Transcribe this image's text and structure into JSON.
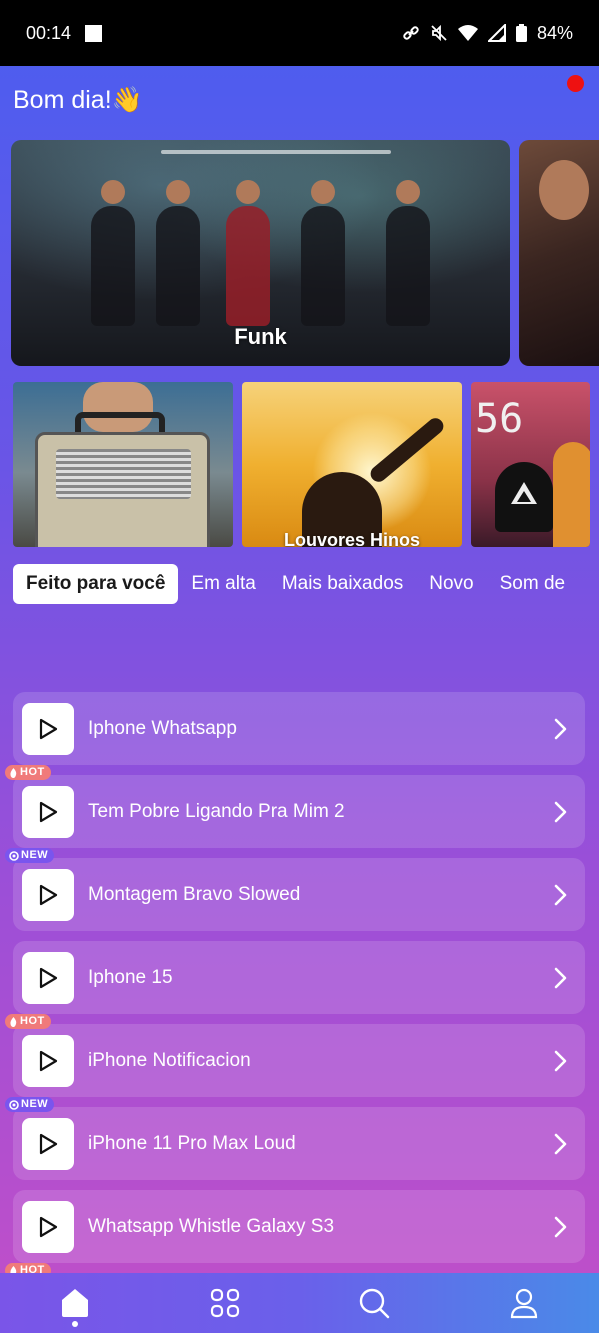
{
  "status_bar": {
    "time": "00:14",
    "battery": "84%"
  },
  "header": {
    "greeting": "Bom dia!👋"
  },
  "banners": [
    {
      "label": "Funk"
    },
    {
      "label": ""
    }
  ],
  "tiles": [
    {
      "label": ""
    },
    {
      "label": "Louvores Hinos"
    },
    {
      "label": "",
      "overlay_text": "56"
    }
  ],
  "tabs": [
    {
      "label": "Feito para você",
      "active": true
    },
    {
      "label": "Em alta"
    },
    {
      "label": "Mais baixados"
    },
    {
      "label": "Novo"
    },
    {
      "label": "Som de"
    }
  ],
  "ringtones": [
    {
      "title": "Iphone Whatsapp",
      "badge": ""
    },
    {
      "title": "Tem Pobre Ligando Pra Mim 2",
      "badge": "HOT"
    },
    {
      "title": "Montagem Bravo Slowed",
      "badge": "NEW"
    },
    {
      "title": "Iphone 15",
      "badge": ""
    },
    {
      "title": "iPhone Notificacion",
      "badge": "HOT"
    },
    {
      "title": "iPhone 11 Pro Max Loud",
      "badge": "NEW"
    },
    {
      "title": "Whatsapp Whistle Galaxy S3",
      "badge": ""
    }
  ],
  "partial_badge": "HOT",
  "bottom_nav": [
    {
      "icon": "home-icon",
      "active": true
    },
    {
      "icon": "grid-icon"
    },
    {
      "icon": "search-icon"
    },
    {
      "icon": "profile-icon"
    }
  ],
  "colors": {
    "accent": "#4a5ef0",
    "hot_badge": "#f07a7a",
    "new_badge": "#7a55ee",
    "notification_dot": "#ee1111"
  }
}
